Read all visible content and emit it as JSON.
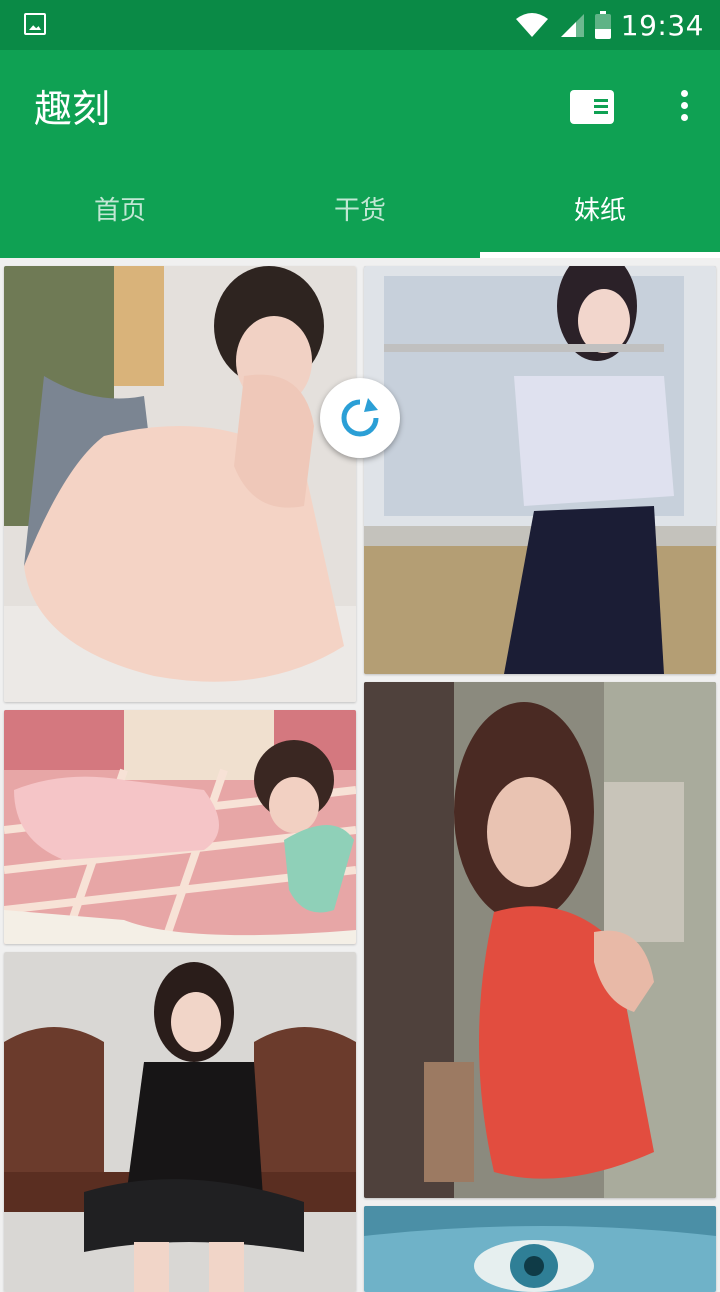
{
  "status_bar": {
    "time": "19:34",
    "icons": [
      "image-notification-icon",
      "wifi-icon",
      "cell-signal-icon",
      "battery-icon"
    ]
  },
  "app_bar": {
    "title": "趣刻",
    "actions": [
      "view-toggle-icon",
      "more-vert-icon"
    ]
  },
  "tabs": [
    {
      "label": "首页",
      "active": false
    },
    {
      "label": "干货",
      "active": false
    },
    {
      "label": "妹纸",
      "active": true
    }
  ],
  "colors": {
    "status_bar": "#0a8a46",
    "app_bar": "#0fa153",
    "accent_refresh": "#2b9fd6"
  },
  "photos": [
    {
      "name": "photo-girl-sitting-knees-up",
      "column": 1
    },
    {
      "name": "photo-girl-playing-flute",
      "column": 2
    },
    {
      "name": "photo-girl-lying-on-bed",
      "column": 1
    },
    {
      "name": "photo-girl-red-dress-wall",
      "column": 2
    },
    {
      "name": "photo-girl-black-dress-bench",
      "column": 1
    },
    {
      "name": "photo-girl-closeup-eyes",
      "column": 2
    }
  ],
  "refresh_indicator": "refresh-icon"
}
